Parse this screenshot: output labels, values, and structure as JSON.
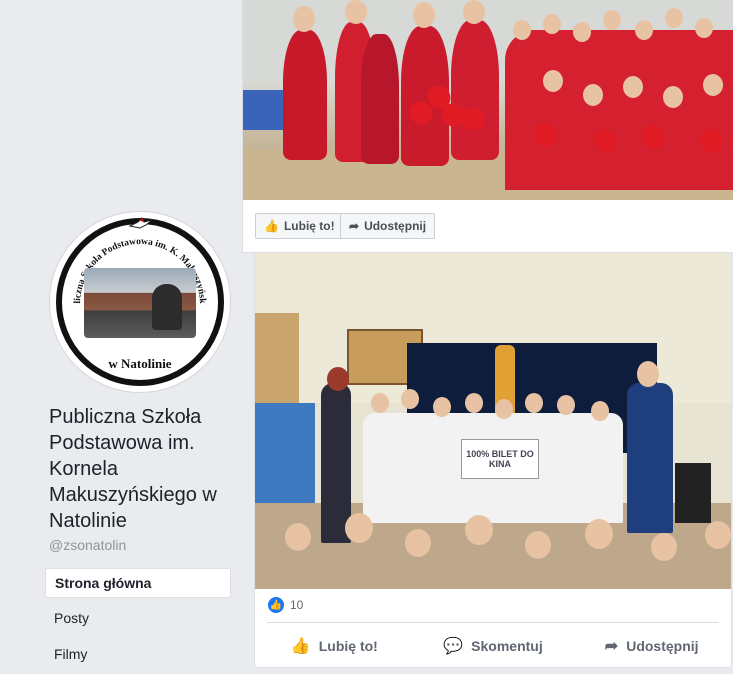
{
  "sidebar": {
    "logo": {
      "arc_text": "Publiczna Szkoła Podstawowa im. K. Makuszyńskiego",
      "bottom_text": "w Natolinie"
    },
    "page_name": "Publiczna Szkoła Podstawowa im. Kornela Makuszyńskiego w Natolinie",
    "handle": "@zsonatolin",
    "nav": [
      {
        "label": "Strona główna",
        "active": true
      },
      {
        "label": "Posty",
        "active": false
      },
      {
        "label": "Filmy",
        "active": false
      }
    ]
  },
  "post1": {
    "like_label": "Lubię to!",
    "share_label": "Udostępnij"
  },
  "post2": {
    "photo_sign": "100% BILET DO KINA",
    "reaction_count": "10",
    "like_label": "Lubię to!",
    "comment_label": "Skomentuj",
    "share_label": "Udostępnij"
  },
  "colors": {
    "accent": "#1877f2",
    "page_bg": "#e9ebee",
    "text": "#1d2129",
    "muted": "#90949c"
  }
}
